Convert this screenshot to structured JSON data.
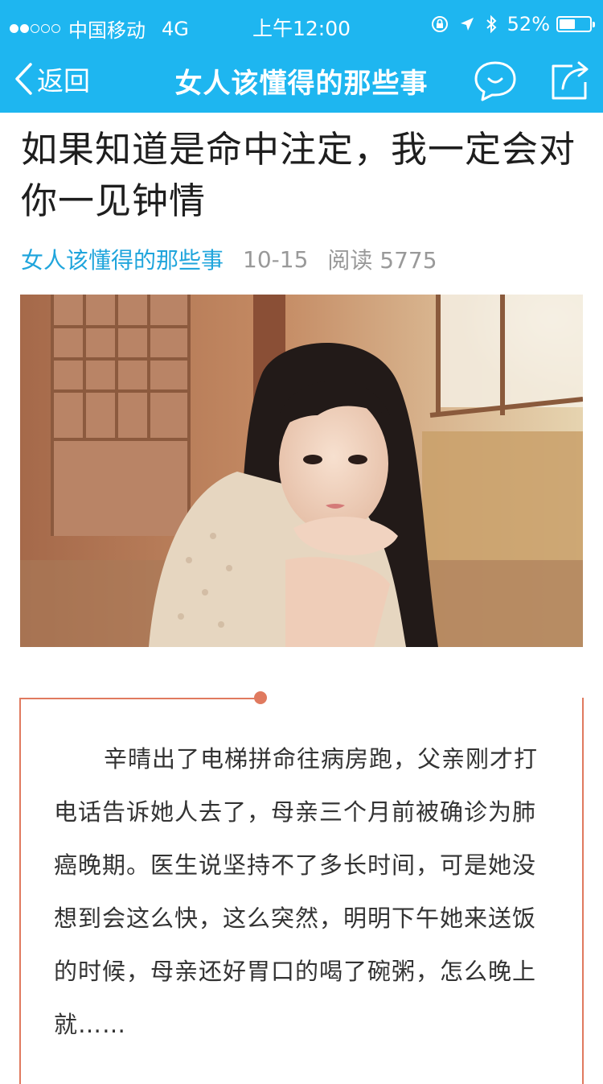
{
  "status_bar": {
    "carrier": "中国移动",
    "network": "4G",
    "time": "上午12:00",
    "battery": "52%",
    "battery_level": 0.52,
    "signal_bars": 2
  },
  "nav": {
    "back_label": "返回",
    "title": "女人该懂得的那些事"
  },
  "article": {
    "title": "如果知道是命中注定，我一定会对你一见钟情",
    "author": "女人该懂得的那些事",
    "date": "10-15",
    "reads": "阅读 5775",
    "body": "辛晴出了电梯拼命往病房跑，父亲刚才打电话告诉她人去了，母亲三个月前被确诊为肺癌晚期。医生说坚持不了多长时间，可是她没想到会这么快，这么突然，明明下午她来送饭的时候，母亲还好胃口的喝了碗粥，怎么晚上就……"
  },
  "colors": {
    "nav_bg": "#1eb6f0",
    "accent_blue": "#20a5dc",
    "frame_orange": "#e07a5f"
  },
  "icons": [
    "chevron-left-icon",
    "comment-icon",
    "share-icon",
    "location-arrow-icon",
    "bluetooth-icon",
    "rotation-lock-icon"
  ]
}
